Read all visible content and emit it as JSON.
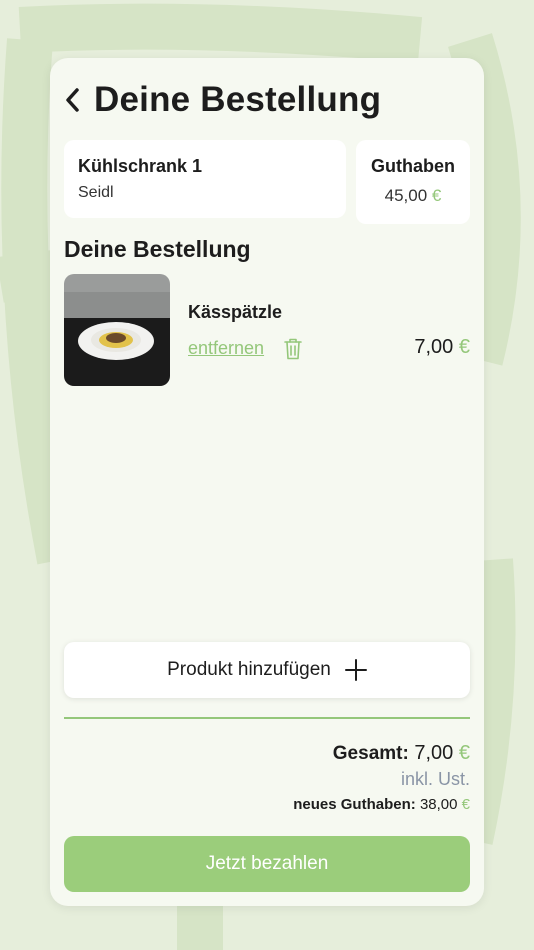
{
  "header": {
    "title": "Deine Bestellung"
  },
  "fridge": {
    "name": "Kühlschrank 1",
    "location": "Seidl"
  },
  "credit": {
    "label": "Guthaben",
    "amount": "45,00",
    "currency": "€"
  },
  "order": {
    "section_title": "Deine Bestellung",
    "items": [
      {
        "name": "Kässpätzle",
        "remove_label": "entfernen",
        "price": "7,00",
        "currency": "€",
        "image": "dish-photo"
      }
    ]
  },
  "actions": {
    "add_product": "Produkt hinzufügen",
    "pay": "Jetzt bezahlen"
  },
  "summary": {
    "total_label": "Gesamt:",
    "total_value": "7,00",
    "currency": "€",
    "tax_note": "inkl. Ust.",
    "new_credit_label": "neues Guthaben:",
    "new_credit_value": "38,00"
  },
  "colors": {
    "accent": "#94c77a",
    "button": "#9bcd7b",
    "background": "#e6eedb",
    "card": "#f6f9f1"
  },
  "icons": {
    "back": "chevron-left-icon",
    "trash": "trash-icon",
    "plus": "plus-icon"
  }
}
